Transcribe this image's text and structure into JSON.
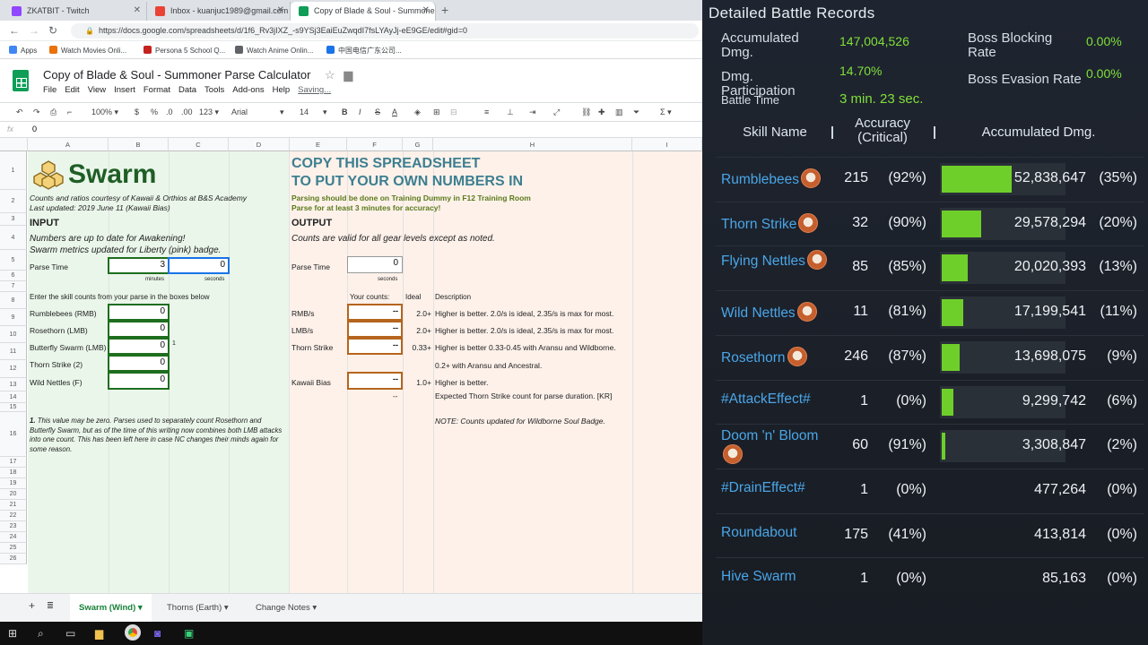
{
  "browser": {
    "tabs": [
      {
        "title": "ZKATBIT - Twitch",
        "color": "#9146ff"
      },
      {
        "title": "Inbox - kuanjuc1989@gmail.com",
        "color": "#ea4335"
      },
      {
        "title": "Copy of Blade & Soul - Summoner",
        "color": "#0f9d58"
      }
    ],
    "new_tab_icon": "+",
    "url": "https://docs.google.com/spreadsheets/d/1f6_Rv3jIXZ_-s9YSj3EaiEuZwqdI7fsLYAyJj-eE9GE/edit#gid=0",
    "bookmarks": [
      {
        "label": "Apps",
        "color": "#4285f4"
      },
      {
        "label": "Watch Movies Onli...",
        "color": "#e8710a"
      },
      {
        "label": "Persona 5 School Q...",
        "color": "#c5221f"
      },
      {
        "label": "Watch Anime Onlin...",
        "color": "#5f6368"
      },
      {
        "label": "中国电信广东公司...",
        "color": "#1a73e8"
      }
    ]
  },
  "sheets": {
    "title": "Copy of Blade & Soul - Summoner Parse Calculator",
    "menus": [
      "File",
      "Edit",
      "View",
      "Insert",
      "Format",
      "Data",
      "Tools",
      "Add-ons",
      "Help"
    ],
    "saving": "Saving...",
    "toolbar": {
      "zoom": "100%",
      "currency": "$",
      "percent": "%",
      "dec1": ".0",
      "dec2": ".00",
      "fmt": "123",
      "font": "Arial",
      "size": "14"
    },
    "fx_value": "0",
    "columns": [
      "A",
      "B",
      "C",
      "D",
      "E",
      "F",
      "G",
      "H",
      "I"
    ],
    "rows": [
      "1",
      "2",
      "3",
      "4",
      "5",
      "6",
      "7",
      "8",
      "9",
      "10",
      "11",
      "12",
      "13",
      "14",
      "15",
      "16",
      "17",
      "18",
      "19",
      "20",
      "21",
      "22",
      "23",
      "24",
      "25",
      "26"
    ],
    "left": {
      "logo": "Swarm",
      "credits1": "Counts and ratios courtesy of Kawaii & Orthios at B&S Academy",
      "credits2": "Last updated: 2019 June 11 (Kawaii Bias)",
      "input_header": "INPUT",
      "note1": "Numbers are up to date for Awakening!",
      "note2": "Swarm metrics updated for Liberty (pink) badge.",
      "parse_time_label": "Parse Time",
      "minutes_value": "3",
      "seconds_value": "0",
      "minutes_label": "minutes",
      "seconds_label": "seconds",
      "enter_counts": "Enter the skill counts from your parse in the boxes below",
      "skills": [
        {
          "label": "Rumblebees (RMB)",
          "value": "0"
        },
        {
          "label": "Rosethorn (LMB)",
          "value": "0"
        },
        {
          "label": "Butterfly Swarm (LMB)",
          "value": "0"
        },
        {
          "label": "Thorn Strike (2)",
          "value": "0"
        },
        {
          "label": "Wild Nettles (F)",
          "value": "0"
        }
      ],
      "footnote_marker": "1",
      "footnote_num": "1.",
      "footnote": "This value may be zero. Parses used to separately count Rosethorn and Butterfly Swarm, but as of the time of this writing now combines both LMB attacks into one count. This has been left here in case NC changes their minds again for some reason."
    },
    "right": {
      "headline1": "COPY THIS SPREADSHEET",
      "headline2": "TO PUT YOUR OWN NUMBERS IN",
      "advice1": "Parsing should be done on Training Dummy in F12 Training Room",
      "advice2": "Parse for at least 3 minutes for accuracy!",
      "output_header": "OUTPUT",
      "valid_note": "Counts are valid for all gear levels except as noted.",
      "parse_time_label": "Parse Time",
      "parse_time_value": "0",
      "seconds_label": "seconds",
      "col_your_counts": "Your counts:",
      "col_ideal": "Ideal",
      "col_description": "Description",
      "outputs": [
        {
          "label": "RMB/s",
          "value": "--",
          "ideal": "2.0+",
          "desc": "Higher is better. 2.0/s is ideal, 2.35/s is max for most."
        },
        {
          "label": "LMB/s",
          "value": "--",
          "ideal": "2.0+",
          "desc": "Higher is better. 2.0/s is ideal, 2.35/s is max for most."
        },
        {
          "label": "Thorn Strike",
          "value": "--",
          "ideal": "0.33+",
          "desc": "Higher is better 0.33-0.45 with Aransu and Wildborne."
        },
        {
          "label": "",
          "value": "",
          "ideal": "",
          "desc": "0.2+ with Aransu and Ancestral."
        },
        {
          "label": "Kawaii Bias",
          "value": "--",
          "ideal": "1.0+",
          "desc": "Higher is better."
        }
      ],
      "row13_value": "--",
      "row13_desc": "Expected Thorn Strike count for parse duration. [KR]",
      "note_badge": "NOTE: Counts updated for Wildborne Soul Badge."
    },
    "sheet_tabs": [
      "Swarm (Wind)",
      "Thorns (Earth)",
      "Change Notes"
    ]
  },
  "battle": {
    "title": "Detailed Battle Records",
    "accumulated_label": "Accumulated Dmg.",
    "accumulated_value": "147,004,526",
    "participation_label": "Dmg. Participation",
    "participation_value": "14.70%",
    "battle_time_label": "Battle Time",
    "battle_time_value": "3 min. 23 sec.",
    "boss_block_label": "Boss Blocking Rate",
    "boss_block_value": "0.00%",
    "boss_evasion_label": "Boss Evasion Rate",
    "boss_evasion_value": "0.00%",
    "col_skill": "Skill Name",
    "col_accuracy": "Accuracy (Critical)",
    "col_dmg": "Accumulated Dmg.",
    "skills": [
      {
        "name": "Rumblebees",
        "paw": true,
        "count": "215",
        "acc": "(92%)",
        "dmg": "52,838,647",
        "pct": "(35%)",
        "share": 0.35
      },
      {
        "name": "Thorn Strike",
        "paw": true,
        "count": "32",
        "acc": "(90%)",
        "dmg": "29,578,294",
        "pct": "(20%)",
        "share": 0.2
      },
      {
        "name": "Flying Nettles",
        "paw": true,
        "count": "85",
        "acc": "(85%)",
        "dmg": "20,020,393",
        "pct": "(13%)",
        "share": 0.13
      },
      {
        "name": "Wild Nettles",
        "paw": true,
        "count": "11",
        "acc": "(81%)",
        "dmg": "17,199,541",
        "pct": "(11%)",
        "share": 0.11
      },
      {
        "name": "Rosethorn",
        "paw": true,
        "count": "246",
        "acc": "(87%)",
        "dmg": "13,698,075",
        "pct": "(9%)",
        "share": 0.09
      },
      {
        "name": "#AttackEffect#",
        "paw": false,
        "count": "1",
        "acc": "(0%)",
        "dmg": "9,299,742",
        "pct": "(6%)",
        "share": 0.06
      },
      {
        "name": "Doom 'n' Bloom",
        "paw": true,
        "count": "60",
        "acc": "(91%)",
        "dmg": "3,308,847",
        "pct": "(2%)",
        "share": 0.02
      },
      {
        "name": "#DrainEffect#",
        "paw": false,
        "count": "1",
        "acc": "(0%)",
        "dmg": "477,264",
        "pct": "(0%)",
        "share": 0
      },
      {
        "name": "Roundabout",
        "paw": false,
        "count": "175",
        "acc": "(41%)",
        "dmg": "413,814",
        "pct": "(0%)",
        "share": 0
      },
      {
        "name": "Hive Swarm",
        "paw": false,
        "count": "1",
        "acc": "(0%)",
        "dmg": "85,163",
        "pct": "(0%)",
        "share": 0
      }
    ]
  }
}
